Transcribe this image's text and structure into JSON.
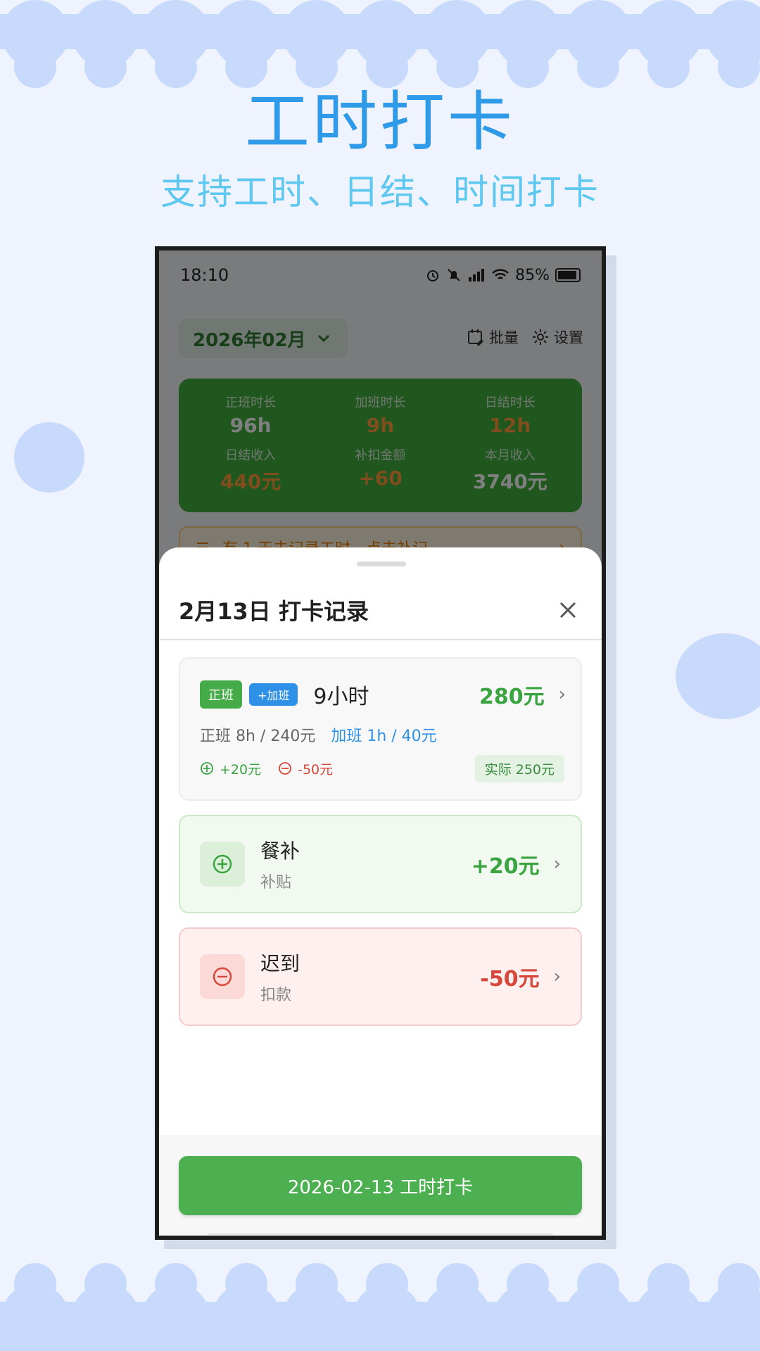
{
  "promo": {
    "title": "工时打卡",
    "subtitle": "支持工时、日结、时间打卡"
  },
  "status_bar": {
    "time": "18:10",
    "battery": "85%"
  },
  "header": {
    "month": "2026年02月",
    "batch_label": "批量",
    "settings_label": "设置"
  },
  "stats": [
    {
      "label": "正班时长",
      "value": "96h",
      "color": "white"
    },
    {
      "label": "加班时长",
      "value": "9h",
      "color": "orange"
    },
    {
      "label": "日结时长",
      "value": "12h",
      "color": "orange"
    },
    {
      "label": "日结收入",
      "value": "440元",
      "color": "orange"
    },
    {
      "label": "补扣金额",
      "value": "+60",
      "color": "orange"
    },
    {
      "label": "本月收入",
      "value": "3740元",
      "color": "white"
    }
  ],
  "reminder": {
    "text": "有 1 天未记录工时，点击补记"
  },
  "sheet": {
    "title": "2月13日 打卡记录",
    "record": {
      "tag_regular": "正班",
      "tag_overtime": "+加班",
      "hours": "9小时",
      "amount": "280元",
      "regular_detail": "正班 8h / 240元",
      "overtime_detail": "加班 1h / 40元",
      "plus_amount": "+20元",
      "minus_amount": "-50元",
      "actual": "实际 250元"
    },
    "allowance": {
      "title": "餐补",
      "subtitle": "补贴",
      "amount": "+20元"
    },
    "deduction": {
      "title": "迟到",
      "subtitle": "扣款",
      "amount": "-50元"
    },
    "button_label": "2026-02-13 工时打卡"
  },
  "colors": {
    "brand_green": "#4caf50",
    "accent_blue": "#2f90e8",
    "deduct_red": "#d8473c",
    "title_blue": "#2f9be8",
    "subtitle_cyan": "#5ec8f0"
  }
}
